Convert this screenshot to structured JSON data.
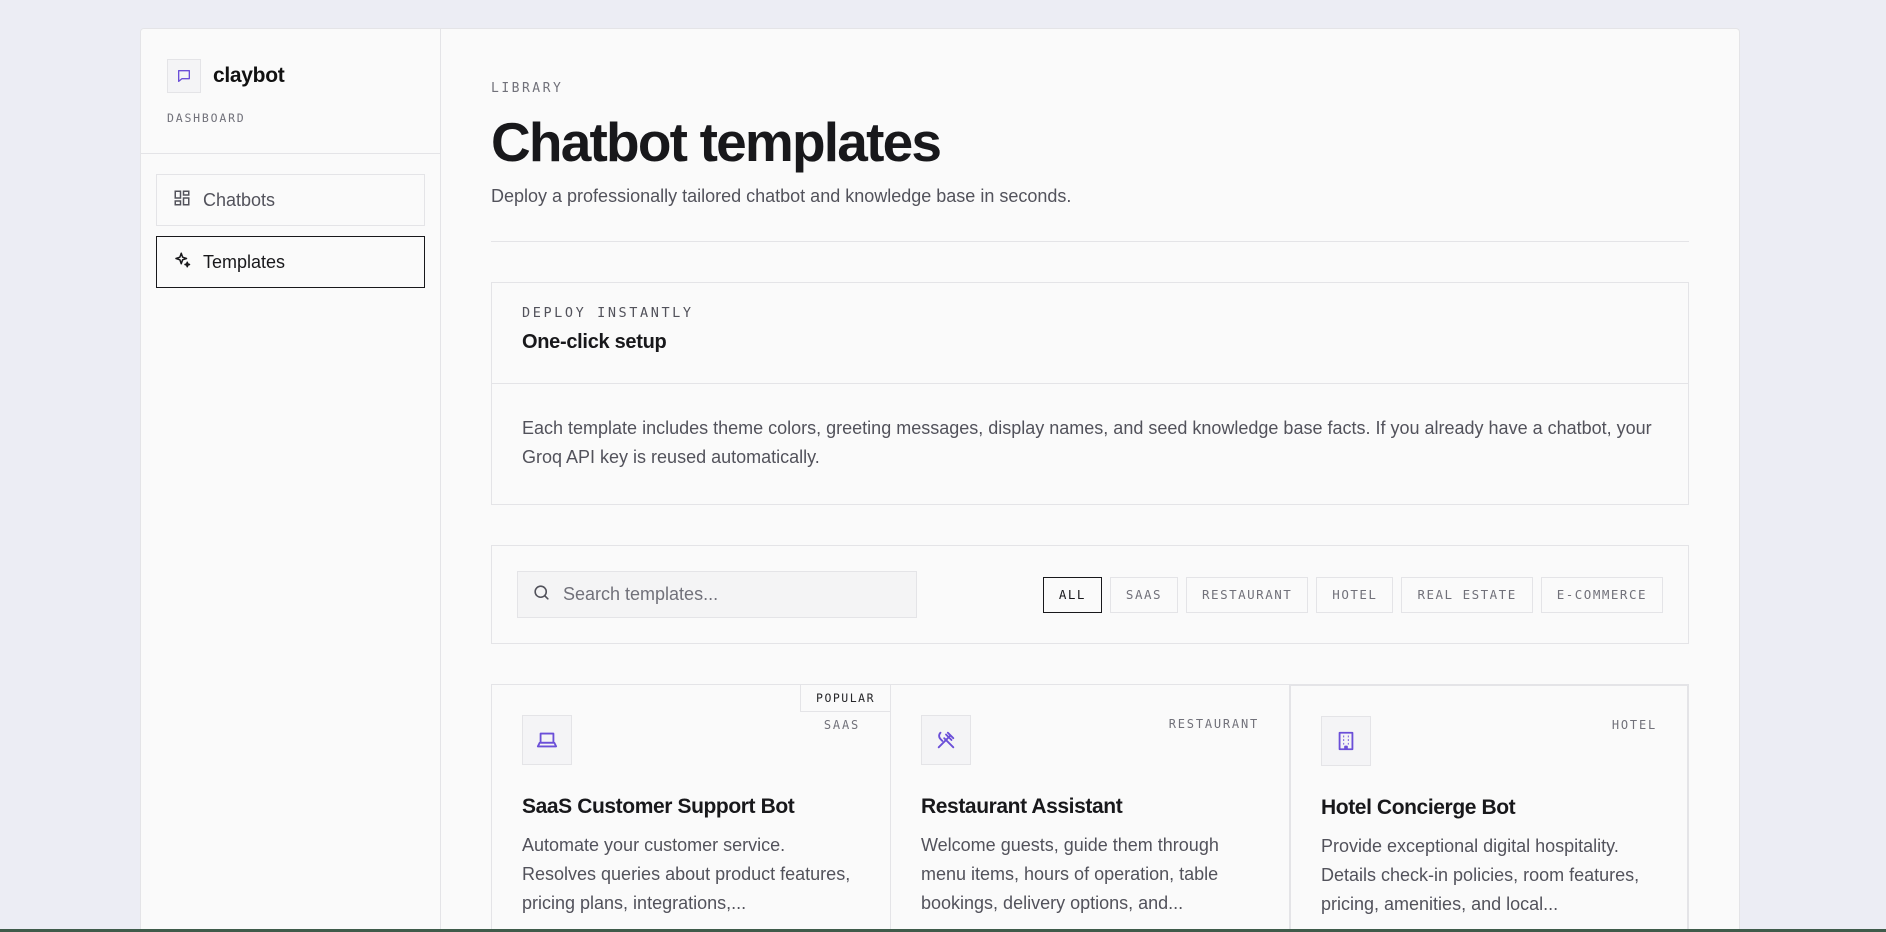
{
  "brand": {
    "name": "claybot",
    "subtitle": "DASHBOARD",
    "logo_icon": "chat-bubble-icon"
  },
  "sidebar": {
    "items": [
      {
        "label": "Chatbots",
        "icon": "dashboard-grid-icon",
        "active": false
      },
      {
        "label": "Templates",
        "icon": "sparkles-icon",
        "active": true
      }
    ]
  },
  "header": {
    "eyebrow": "LIBRARY",
    "title": "Chatbot templates",
    "subtitle": "Deploy a professionally tailored chatbot and knowledge base in seconds."
  },
  "info": {
    "eyebrow": "DEPLOY INSTANTLY",
    "title": "One-click setup",
    "body": "Each template includes theme colors, greeting messages, display names, and seed knowledge base facts. If you already have a chatbot, your Groq API key is reused automatically."
  },
  "search": {
    "placeholder": "Search templates...",
    "value": ""
  },
  "filters": [
    "ALL",
    "SAAS",
    "RESTAURANT",
    "HOTEL",
    "REAL ESTATE",
    "E-COMMERCE"
  ],
  "active_filter": "ALL",
  "templates": [
    {
      "badge": "POPULAR",
      "category": "SAAS",
      "icon": "laptop-icon",
      "title": "SaaS Customer Support Bot",
      "description": "Automate your customer service. Resolves queries about product features, pricing plans, integrations,..."
    },
    {
      "category": "RESTAURANT",
      "icon": "utensils-icon",
      "title": "Restaurant Assistant",
      "description": "Welcome guests, guide them through menu items, hours of operation, table bookings, delivery options, and..."
    },
    {
      "category": "HOTEL",
      "icon": "building-icon",
      "title": "Hotel Concierge Bot",
      "description": "Provide exceptional digital hospitality. Details check-in policies, room features, pricing, amenities, and local..."
    }
  ],
  "colors": {
    "accent": "#6b4fd8",
    "background": "#ecedf4",
    "surface": "#fafafa",
    "border": "#e4e4e7"
  }
}
